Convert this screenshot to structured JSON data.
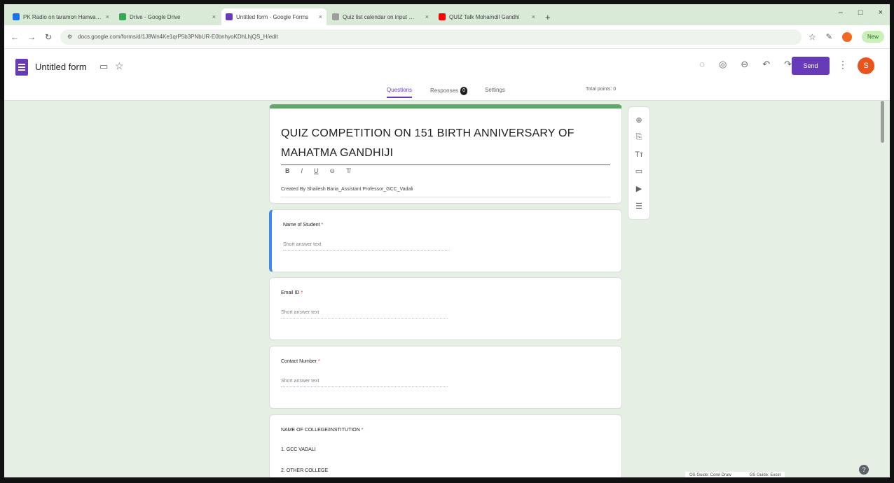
{
  "browser": {
    "tabs": [
      {
        "label": "PK Radio on taramon Hanwat …",
        "favicon_color": "#1a73e8",
        "active": false
      },
      {
        "label": "Drive - Google Drive",
        "favicon_color": "#34a853",
        "active": false
      },
      {
        "label": "Untitled form - Google Forms",
        "favicon_color": "#673ab7",
        "active": true
      },
      {
        "label": "Quiz list calendar on input …",
        "favicon_color": "#9e9e9e",
        "active": false
      },
      {
        "label": "QUIZ Talk Mohamdil Gandhi",
        "favicon_color": "#ff0000",
        "active": false
      }
    ],
    "new_tab": "+",
    "window_controls": [
      "–",
      "□",
      "×"
    ],
    "url": "docs.google.com/forms/d/1J8Wn4Ke1qrP5b3PNbUR-E0bnhyoKDhLhjQS_H/edit",
    "new_label": "New"
  },
  "form": {
    "title": "Untitled form",
    "send_label": "Send",
    "avatar_letter": "S",
    "tabs": {
      "questions": "Questions",
      "responses": "Responses",
      "responses_count": "0",
      "settings": "Settings"
    },
    "points": "Total points: 0"
  },
  "header_card": {
    "title": "QUIZ COMPETITION ON 151 BIRTH ANNIVERSARY OF MAHATMA GANDHIJI",
    "format_buttons": [
      "B",
      "I",
      "U",
      "⊖",
      "T̸"
    ],
    "description": "Created By Shailesh Baria_Assistant Professor_GCC_Vadali"
  },
  "questions": [
    {
      "label": "Name of Student",
      "required": "*",
      "placeholder": "Short answer text"
    },
    {
      "label": "Email ID",
      "required": "*",
      "placeholder": "Short answer text"
    },
    {
      "label": "Contact Number",
      "required": "*",
      "placeholder": "Short answer text"
    },
    {
      "label": "NAME OF COLLEGE/INSTITUTION",
      "required": "*",
      "choices": [
        "1.  GCC VADALI",
        "2.  OTHER COLLEGE"
      ]
    }
  ],
  "toolbar_icons": [
    "add-question-icon",
    "import-questions-icon",
    "add-title-icon",
    "add-image-icon",
    "add-video-icon",
    "add-section-icon"
  ],
  "status_bar": [
    "OS Guide: Corel Draw",
    "GS Guide: Excel"
  ]
}
